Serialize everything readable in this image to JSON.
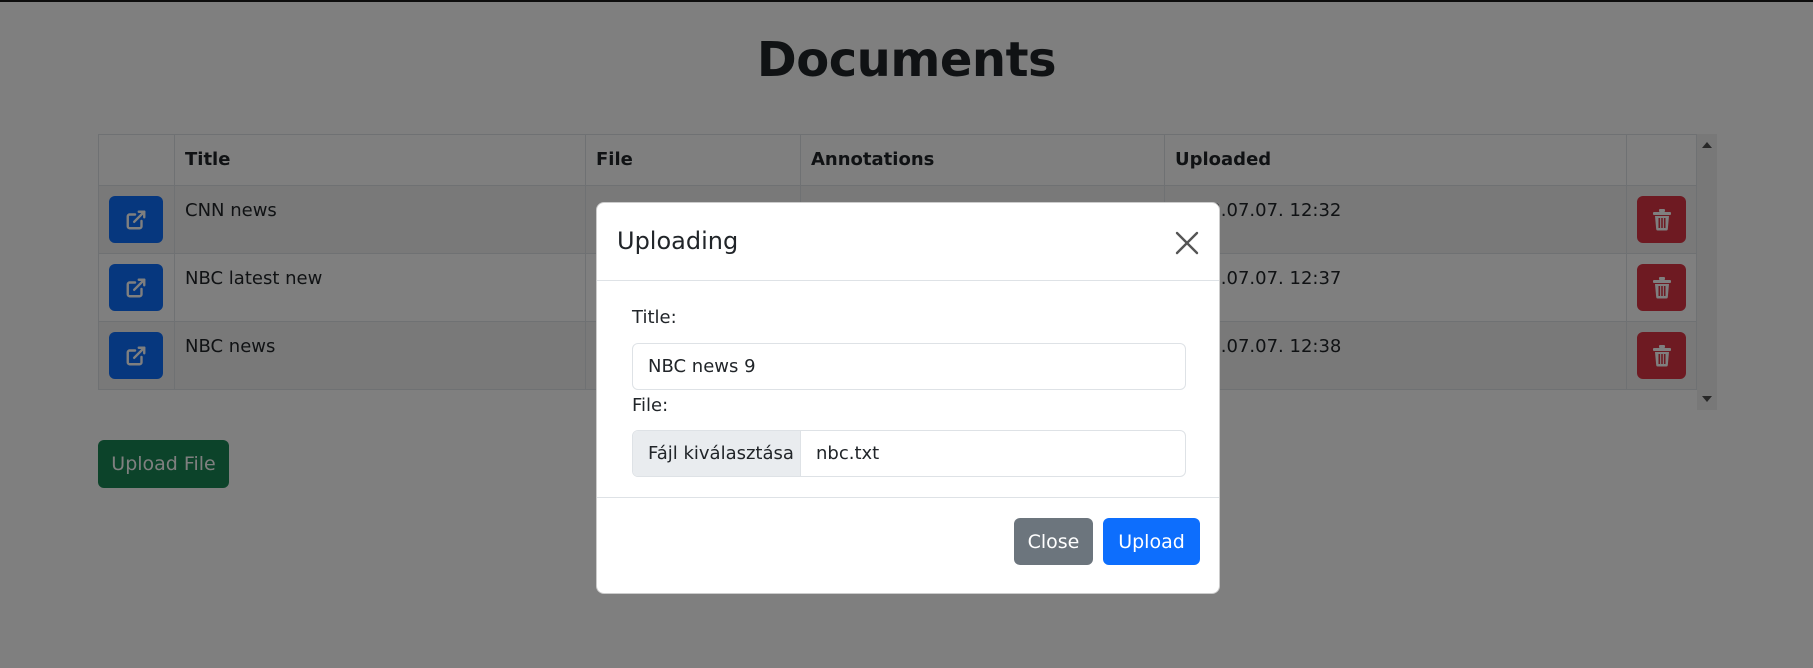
{
  "page": {
    "title": "Documents"
  },
  "table": {
    "headers": {
      "title": "Title",
      "file": "File",
      "annotations": "Annotations",
      "uploaded": "Uploaded"
    },
    "rows": [
      {
        "title": "CNN news",
        "file": "",
        "annotations": "",
        "uploaded": "2023.07.07. 12:32"
      },
      {
        "title": "NBC latest new",
        "file": "",
        "annotations": "",
        "uploaded": "2023.07.07. 12:37"
      },
      {
        "title": "NBC news",
        "file": "",
        "annotations": "",
        "uploaded": "2023.07.07. 12:38"
      }
    ]
  },
  "actions": {
    "upload_file_label": "Upload File"
  },
  "modal": {
    "title": "Uploading",
    "title_label": "Title:",
    "title_value": "NBC news 9",
    "file_label": "File:",
    "file_choose_label": "Fájl kiválasztása",
    "file_name": "nbc.txt",
    "close_label": "Close",
    "upload_label": "Upload"
  },
  "icons": {
    "edit": "external-link-icon",
    "delete": "trash-icon",
    "close": "close-icon"
  },
  "colors": {
    "primary": "#0d6efd",
    "danger": "#dc3545",
    "success": "#198754",
    "secondary": "#6c757d"
  }
}
